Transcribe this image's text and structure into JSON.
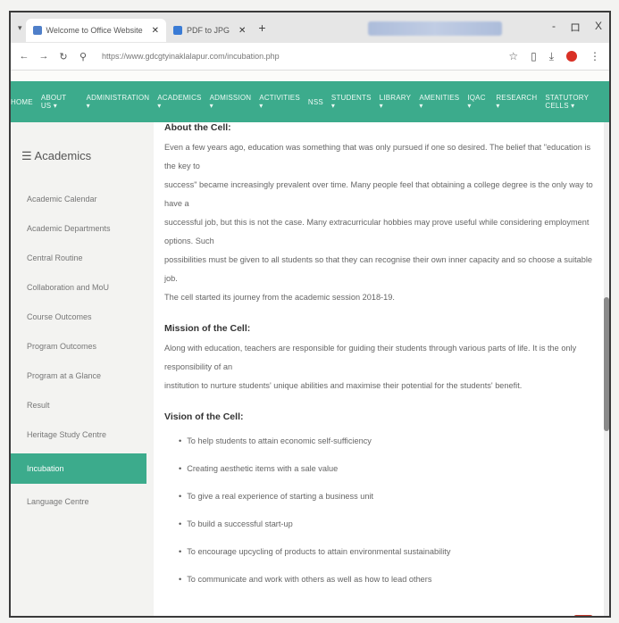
{
  "browser": {
    "tabs": [
      {
        "title": "Welcome to Office Website",
        "active": true
      },
      {
        "title": "PDF to JPG",
        "active": false
      }
    ],
    "new_tab": "+",
    "url": "https://www.gdcgtyinaklalapur.com/incubation.php",
    "window_controls": [
      "-",
      "ロ",
      "X"
    ]
  },
  "nav": {
    "items": [
      "HOME",
      "ABOUT US ▾",
      "ADMINISTRATION ▾",
      "ACADEMICS ▾",
      "ADMISSION ▾",
      "ACTIVITIES ▾",
      "NSS",
      "STUDENTS ▾",
      "LIBRARY ▾",
      "AMENITIES ▾",
      "IQAC ▾",
      "RESEARCH ▾",
      "STATUTORY CELLS ▾"
    ]
  },
  "sidebar": {
    "title": "☰ Academics",
    "items": [
      {
        "label": "Academic Calendar",
        "active": false
      },
      {
        "label": "Academic Departments",
        "active": false
      },
      {
        "label": "Central Routine",
        "active": false
      },
      {
        "label": "Collaboration and MoU",
        "active": false
      },
      {
        "label": "Course Outcomes",
        "active": false
      },
      {
        "label": "Program Outcomes",
        "active": false
      },
      {
        "label": "Program at a Glance",
        "active": false
      },
      {
        "label": "Result",
        "active": false
      },
      {
        "label": "Heritage Study Centre",
        "active": false
      },
      {
        "label": "Incubation",
        "active": true
      },
      {
        "label": "Language Centre",
        "active": false
      }
    ]
  },
  "main": {
    "about": {
      "heading": "About the Cell:",
      "lines": [
        "Even a few years ago, education was something that was only pursued if one so desired. The belief that \"education is the key to",
        "success\" became increasingly prevalent over time. Many people feel that obtaining a college degree is the only way to have a",
        "successful job, but this is not the case. Many extracurricular hobbies may prove useful while considering employment options. Such",
        "possibilities must be given to all students so that they can recognise their own inner capacity and so choose a suitable job.",
        "The cell started its journey from the academic session 2018-19."
      ]
    },
    "mission": {
      "heading": "Mission of the Cell:",
      "lines": [
        "Along with education, teachers are responsible for guiding their students through various parts of life. It is the only responsibility of an",
        "institution to nurture students' unique abilities and maximise their potential for the students' benefit."
      ]
    },
    "vision": {
      "heading": "Vision of the Cell:",
      "items": [
        "To help students to attain economic self-sufficiency",
        "Creating aesthetic items with a sale value",
        "To give a real experience of starting a business unit",
        "To build a successful start-up",
        "To encourage upcycling of products to attain environmental sustainability",
        "To communicate and work with others as well as how to lead others"
      ]
    }
  },
  "colors": {
    "accent": "#3cab8c",
    "red": "#d93025"
  }
}
